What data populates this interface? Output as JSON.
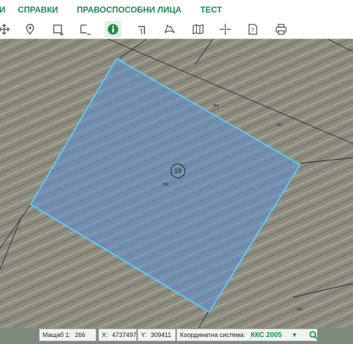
{
  "menu": {
    "items": [
      {
        "label": "И"
      },
      {
        "label": "СПРАВКИ"
      },
      {
        "label": "ПРАВОСПОСОБНИ ЛИЦА"
      },
      {
        "label": "ТЕСТ"
      }
    ]
  },
  "toolbar": {
    "tools": [
      {
        "icon": "pan-arrows-icon",
        "active": false
      },
      {
        "icon": "location-pin-icon",
        "active": false
      },
      {
        "icon": "select-area-icon",
        "active": false
      },
      {
        "icon": "deselect-area-icon",
        "active": false
      },
      {
        "icon": "info-icon",
        "active": true
      },
      {
        "icon": "measure-distance-icon",
        "active": false
      },
      {
        "icon": "measure-area-icon",
        "active": false
      },
      {
        "icon": "map-layers-icon",
        "active": false
      },
      {
        "icon": "coordinates-crosshair-icon",
        "active": false
      },
      {
        "icon": "help-document-icon",
        "active": false
      },
      {
        "icon": "print-icon",
        "active": false
      }
    ],
    "accent_color": "#1f8a4c"
  },
  "map": {
    "highlight_color": "#5ec7e8",
    "plot_number": "19",
    "labels": [
      "264",
      "767",
      "263",
      "246"
    ]
  },
  "status": {
    "scale_label": "Мащаб 1:",
    "scale_value": "266",
    "x_label": "X:",
    "x_value": "4737497",
    "y_label": "Y:",
    "y_value": "309411",
    "crs_label": "Координатна система:",
    "crs_value": "ККС 2005"
  }
}
